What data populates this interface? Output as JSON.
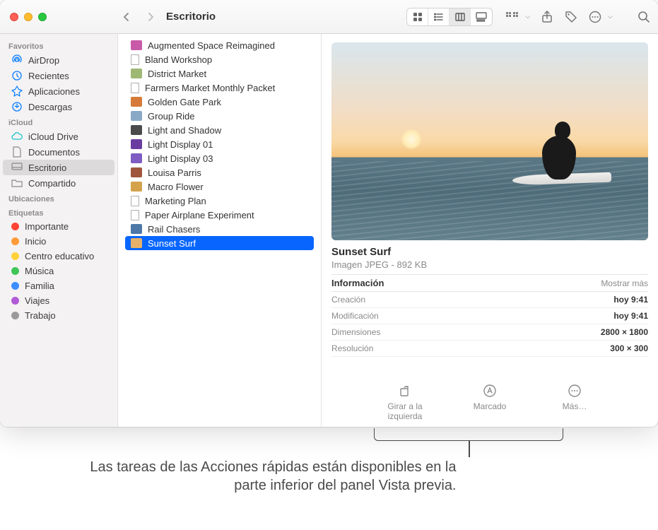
{
  "window": {
    "title": "Escritorio"
  },
  "sidebar": {
    "sections": [
      {
        "heading": "Favoritos",
        "items": [
          {
            "label": "AirDrop",
            "icon": "airdrop"
          },
          {
            "label": "Recientes",
            "icon": "clock"
          },
          {
            "label": "Aplicaciones",
            "icon": "apps"
          },
          {
            "label": "Descargas",
            "icon": "download"
          }
        ]
      },
      {
        "heading": "iCloud",
        "items": [
          {
            "label": "iCloud Drive",
            "icon": "cloud"
          },
          {
            "label": "Documentos",
            "icon": "doc",
            "gray": true
          },
          {
            "label": "Escritorio",
            "icon": "desktop",
            "gray": true,
            "selected": true
          },
          {
            "label": "Compartido",
            "icon": "folder",
            "gray": true
          }
        ]
      },
      {
        "heading": "Ubicaciones",
        "items": []
      },
      {
        "heading": "Etiquetas",
        "items": [
          {
            "label": "Importante",
            "tag": "#ff4436"
          },
          {
            "label": "Inicio",
            "tag": "#ff9a38"
          },
          {
            "label": "Centro educativo",
            "tag": "#ffd23a"
          },
          {
            "label": "Música",
            "tag": "#40c658"
          },
          {
            "label": "Familia",
            "tag": "#3c8dff"
          },
          {
            "label": "Viajes",
            "tag": "#b25bd9"
          },
          {
            "label": "Trabajo",
            "tag": "#9a9a9a"
          }
        ]
      }
    ]
  },
  "files": [
    {
      "name": "Augmented Space Reimagined",
      "thumb": "#c95aa8"
    },
    {
      "name": "Bland Workshop",
      "thumb": "doc"
    },
    {
      "name": "District Market",
      "thumb": "#9fb874"
    },
    {
      "name": "Farmers Market Monthly Packet",
      "thumb": "doc"
    },
    {
      "name": "Golden Gate Park",
      "thumb": "#d67a39"
    },
    {
      "name": "Group Ride",
      "thumb": "#8aa9c7"
    },
    {
      "name": "Light and Shadow",
      "thumb": "#4b4b4b"
    },
    {
      "name": "Light Display 01",
      "thumb": "#6a3ba0"
    },
    {
      "name": "Light Display 03",
      "thumb": "#7e5cc2"
    },
    {
      "name": "Louisa Parris",
      "thumb": "#a0563e"
    },
    {
      "name": "Macro Flower",
      "thumb": "#d4a24a"
    },
    {
      "name": "Marketing Plan",
      "thumb": "doc"
    },
    {
      "name": "Paper Airplane Experiment",
      "thumb": "doc"
    },
    {
      "name": "Rail Chasers",
      "thumb": "#4d78a8"
    },
    {
      "name": "Sunset Surf",
      "thumb": "#e6b168",
      "selected": true
    }
  ],
  "preview": {
    "title": "Sunset Surf",
    "subtitle": "Imagen JPEG - 892 KB",
    "info_label": "Información",
    "show_more": "Mostrar más",
    "rows": [
      {
        "k": "Creación",
        "v": "hoy 9:41",
        "b": true
      },
      {
        "k": "Modificación",
        "v": "hoy 9:41",
        "b": true
      },
      {
        "k": "Dimensiones",
        "v": "2800 × 1800",
        "b": true
      },
      {
        "k": "Resolución",
        "v": "300 × 300",
        "b": true
      }
    ],
    "actions": [
      {
        "name": "rotate-left",
        "label": "Girar a la izquierda"
      },
      {
        "name": "markup",
        "label": "Marcado"
      },
      {
        "name": "more",
        "label": "Más…"
      }
    ]
  },
  "caption": "Las tareas de las Acciones rápidas están disponibles en la parte inferior del panel Vista previa."
}
